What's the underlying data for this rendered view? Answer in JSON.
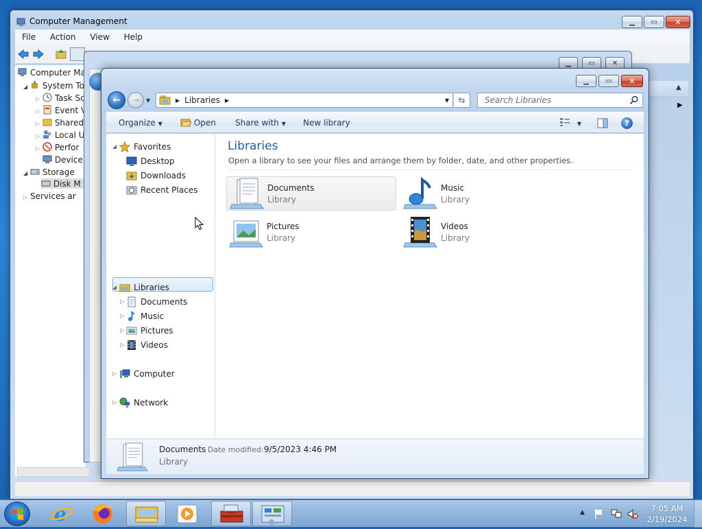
{
  "computer_management": {
    "title": "Computer Management",
    "menu": [
      "File",
      "Action",
      "View",
      "Help"
    ],
    "tree": [
      "Computer Ma",
      "System To",
      "Task Sc",
      "Event V",
      "Shared",
      "Local U",
      "Perfor",
      "Device",
      "Storage",
      "Disk M",
      "Services ar"
    ]
  },
  "explorer": {
    "address": {
      "crumb": "Libraries"
    },
    "search": {
      "placeholder": "Search Libraries"
    },
    "commands": {
      "organize": "Organize",
      "open": "Open",
      "share": "Share with",
      "new_library": "New library"
    },
    "nav": {
      "favorites": "Favorites",
      "desktop": "Desktop",
      "downloads": "Downloads",
      "recent": "Recent Places",
      "libraries": "Libraries",
      "documents": "Documents",
      "music": "Music",
      "pictures": "Pictures",
      "videos": "Videos",
      "computer": "Computer",
      "network": "Network"
    },
    "content": {
      "title": "Libraries",
      "description": "Open a library to see your files and arrange them by folder, date, and other properties.",
      "tiles": [
        {
          "name": "Documents",
          "kind": "Library"
        },
        {
          "name": "Music",
          "kind": "Library"
        },
        {
          "name": "Pictures",
          "kind": "Library"
        },
        {
          "name": "Videos",
          "kind": "Library"
        }
      ]
    },
    "details": {
      "name": "Documents",
      "date_label": "Date modified:",
      "date_value": "9/5/2023 4:46 PM",
      "kind": "Library"
    }
  },
  "taskbar": {
    "time": "7:05 AM",
    "date": "2/19/2024"
  },
  "colors": {
    "accent_blue": "#1e5d9e",
    "close_red": "#c4442b",
    "selection": "#84acdd"
  }
}
